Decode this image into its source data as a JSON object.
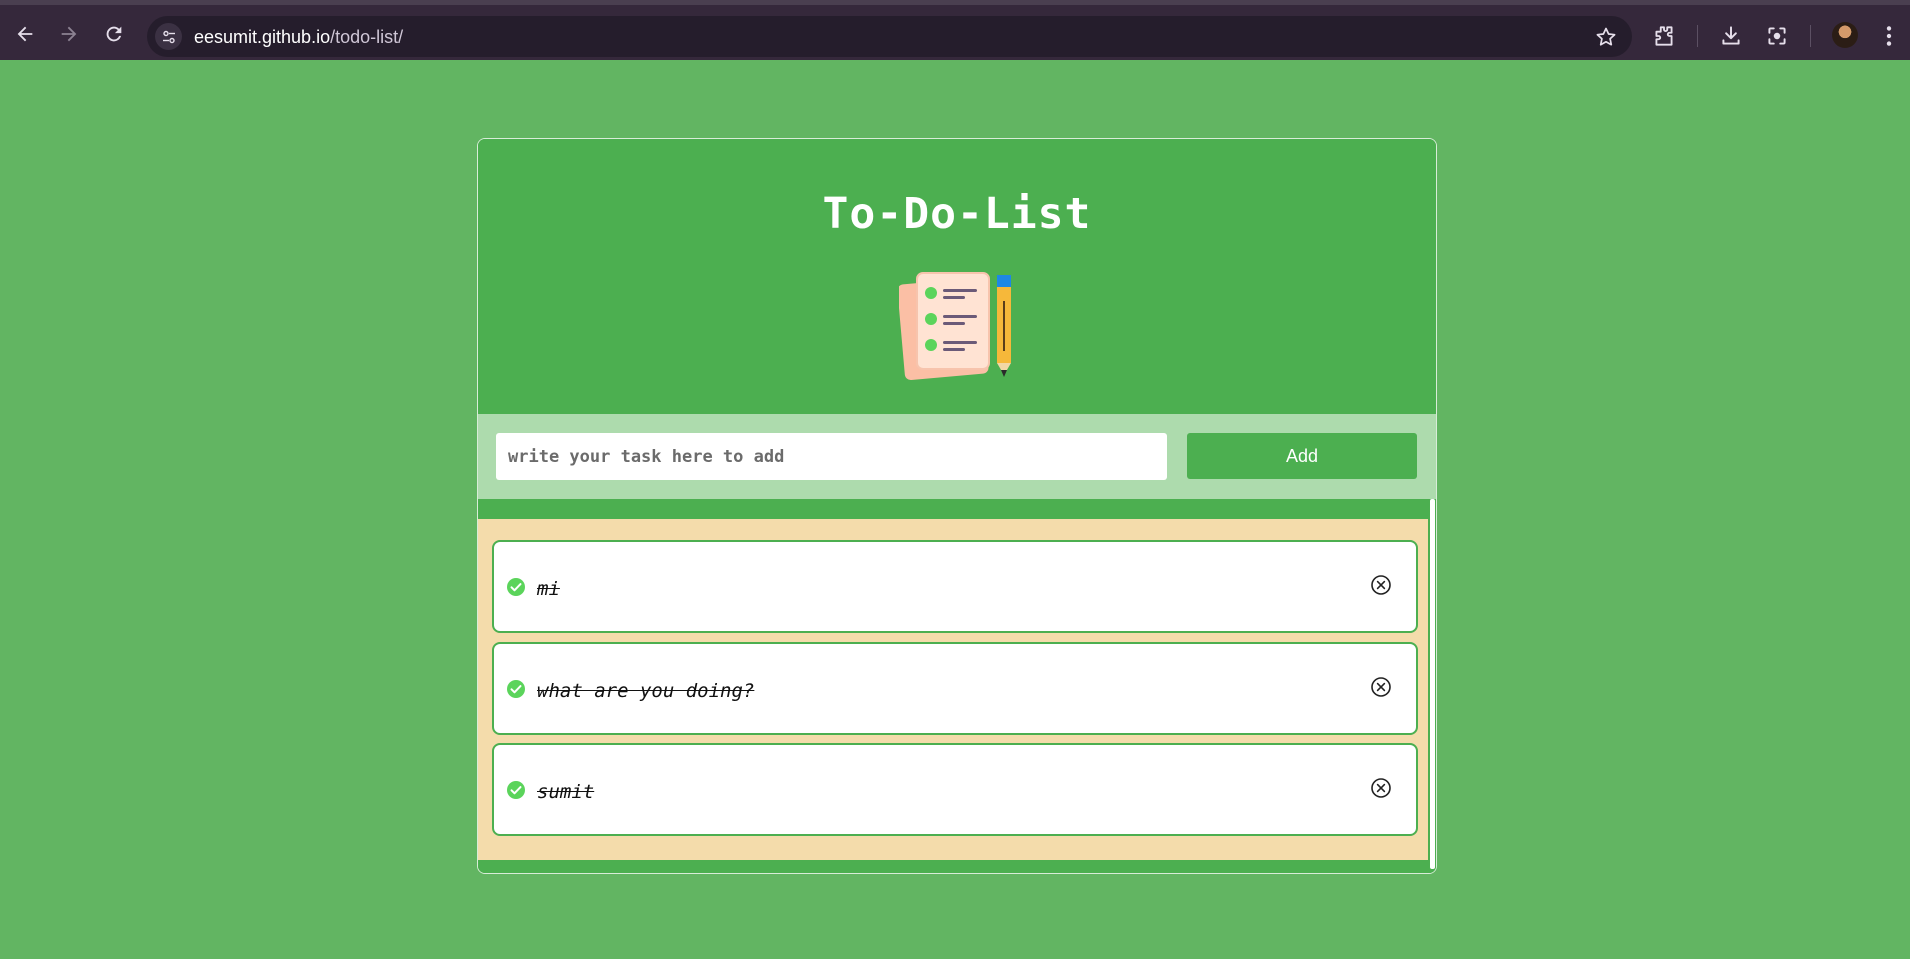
{
  "browser": {
    "url_domain": "eesumit.github.io",
    "url_path": "/todo-list/"
  },
  "app": {
    "title": "To-Do-List",
    "input_placeholder": "write your task here to add",
    "input_value": "",
    "add_label": "Add"
  },
  "tasks": [
    {
      "text": "mi",
      "completed": true
    },
    {
      "text": "what are you doing?",
      "completed": true
    },
    {
      "text": "sumit",
      "completed": true
    }
  ],
  "colors": {
    "page_background": "#62b562",
    "accent_green": "#4caf50",
    "input_band": "#addbad",
    "list_panel": "#f4dcab",
    "check_green": "#5bd45b"
  },
  "icons": {
    "back": "arrow-left-icon",
    "forward": "arrow-right-icon",
    "reload": "reload-icon",
    "site_info": "tune-icon",
    "bookmark": "star-icon",
    "extensions": "puzzle-icon",
    "downloads": "download-icon",
    "lens": "camera-search-icon",
    "menu": "kebab-menu-icon",
    "task_check": "check-circle-icon",
    "task_remove": "close-circle-icon"
  }
}
